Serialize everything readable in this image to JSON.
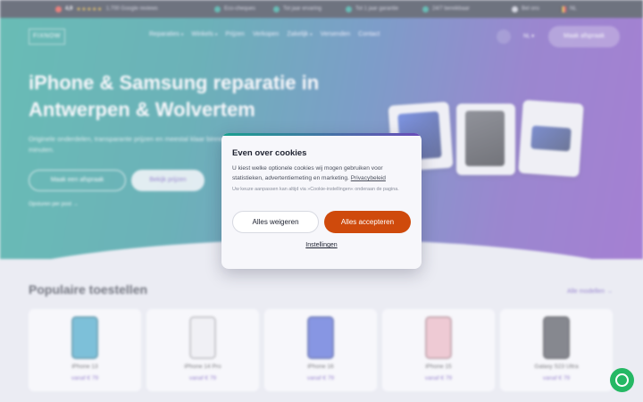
{
  "topbar": {
    "rating": "4,9",
    "stars": "★★★★★",
    "reviews": "1.700 Google reviews",
    "usps": [
      "Eco-cheques",
      "Tot jaar ervaring",
      "Tot 1 jaar garantie",
      "24/7 bereikbaar"
    ],
    "phone": "Bel ons",
    "lang": "NL"
  },
  "nav": {
    "logo": "FIXNOW",
    "links": [
      {
        "label": "Reparaties",
        "chevron": true
      },
      {
        "label": "Winkels",
        "chevron": true
      },
      {
        "label": "Prijzen",
        "chevron": false
      },
      {
        "label": "Verkopen",
        "chevron": false
      },
      {
        "label": "Zakelijk",
        "chevron": true
      },
      {
        "label": "Versenden",
        "chevron": false
      },
      {
        "label": "Contact",
        "chevron": false
      }
    ],
    "lang": "NL",
    "cta": "Maak afspraak"
  },
  "hero": {
    "title": "iPhone & Samsung reparatie in Antwerpen & Wolvertem",
    "subtitle": "Originele onderdelen, transparante prijzen en meestal klaar binnen 60 minuten.",
    "btn_primary": "Maak een afspraak",
    "btn_secondary": "Bekijk prijzen",
    "note": "Opsturen per post →"
  },
  "popular": {
    "title": "Populaire toestellen",
    "all_link": "Alle modellen →",
    "items": [
      {
        "name": "iPhone 13",
        "price": "vanaf € 79",
        "color": "#3aa7c9"
      },
      {
        "name": "iPhone 14 Pro",
        "price": "vanaf € 79",
        "color": "#f4f4f6"
      },
      {
        "name": "iPhone 16",
        "price": "vanaf € 79",
        "color": "#4b63d8"
      },
      {
        "name": "iPhone 15",
        "price": "vanaf € 79",
        "color": "#f1b6c0"
      },
      {
        "name": "Galaxy S23 Ultra",
        "price": "vanaf € 79",
        "color": "#4a4d52"
      }
    ]
  },
  "cookie": {
    "title": "Even over cookies",
    "text": "U kiest welke optionele cookies wij mogen gebruiken voor statistieken, advertentiemeting en marketing.",
    "privacy_link": "Privacybeleid",
    "note": "Uw keuze aanpassen kan altijd via »Cookie-instellingen« onderaan de pagina.",
    "reject": "Alles weigeren",
    "accept": "Alles accepteren",
    "settings": "Instellingen"
  },
  "colors": {
    "accent": "#6a4bb9",
    "teal": "#1aa08f",
    "accept_button": "#cf4a0c",
    "whatsapp": "#25b864"
  }
}
